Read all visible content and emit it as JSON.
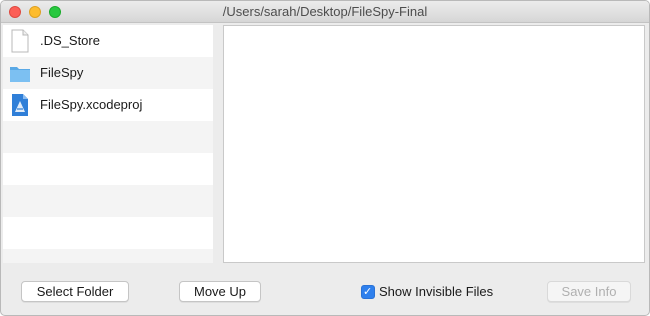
{
  "window": {
    "title": "/Users/sarah/Desktop/FileSpy-Final"
  },
  "files": [
    {
      "name": ".DS_Store",
      "icon": "document-icon"
    },
    {
      "name": "FileSpy",
      "icon": "folder-icon"
    },
    {
      "name": "FileSpy.xcodeproj",
      "icon": "xcode-project-icon"
    }
  ],
  "toolbar": {
    "select_folder_label": "Select Folder",
    "move_up_label": "Move Up",
    "show_invisible_label": "Show Invisible Files",
    "show_invisible_checked": true,
    "save_info_label": "Save Info",
    "save_info_enabled": false
  },
  "colors": {
    "accent": "#2f80ed",
    "folder": "#6eb5ee"
  }
}
